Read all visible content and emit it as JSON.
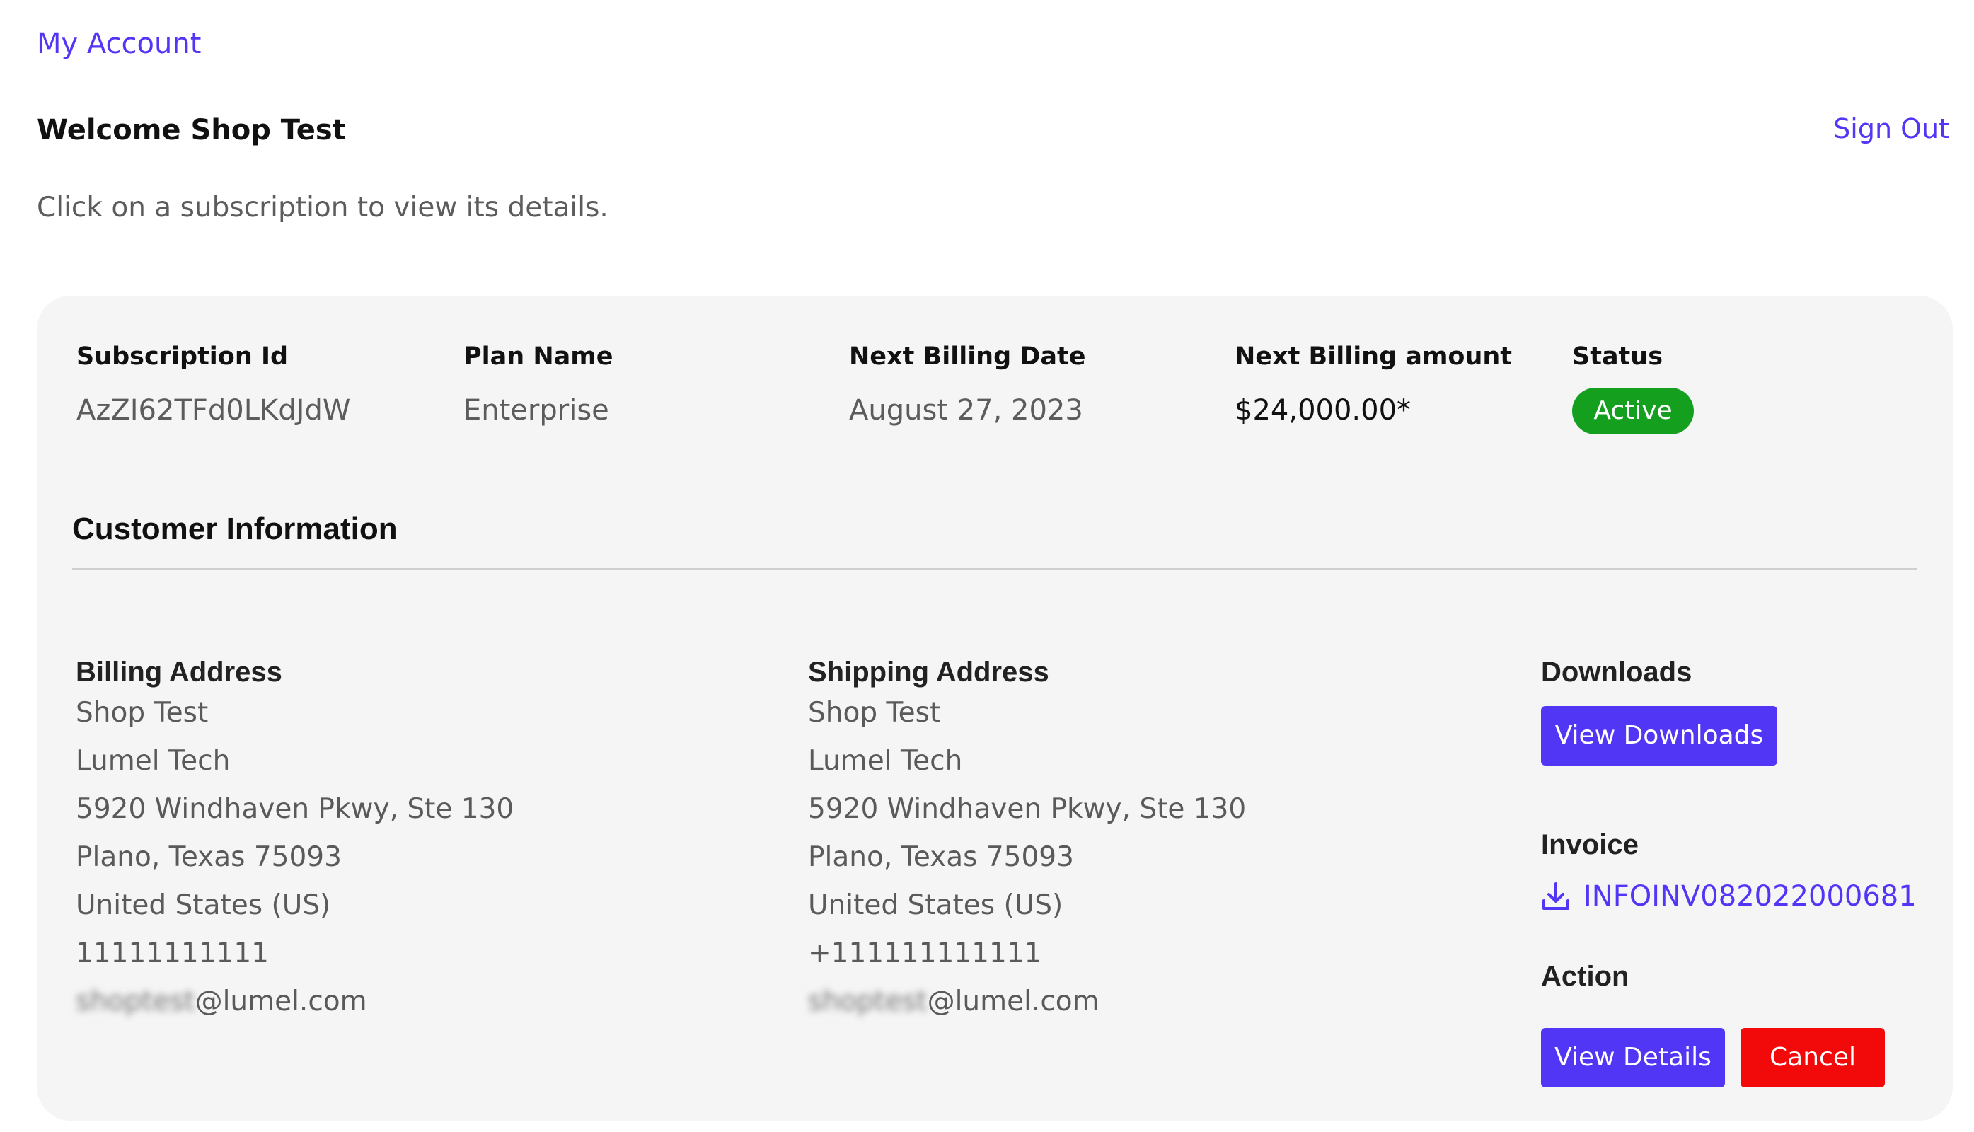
{
  "header": {
    "my_account": "My Account",
    "welcome": "Welcome Shop Test",
    "sign_out": "Sign Out",
    "hint": "Click on a subscription to view its details."
  },
  "subscription": {
    "columns": {
      "id": "Subscription Id",
      "plan": "Plan Name",
      "next_date": "Next Billing Date",
      "next_amount": "Next Billing amount",
      "status": "Status"
    },
    "values": {
      "id": "AzZI62TFd0LKdJdW",
      "plan": "Enterprise",
      "next_date": "August 27, 2023",
      "next_amount": "$24,000.00*",
      "status": "Active"
    },
    "status_color": "#14a01e"
  },
  "customer": {
    "title": "Customer Information",
    "billing": {
      "heading": "Billing Address",
      "name": "Shop Test",
      "company": "Lumel Tech",
      "street": "5920 Windhaven Pkwy, Ste 130",
      "city": "Plano, Texas 75093",
      "country": "United States (US)",
      "phone": "11111111111",
      "email_blurred": "shoptest",
      "email_domain": "@lumel.com"
    },
    "shipping": {
      "heading": "Shipping Address",
      "name": "Shop Test",
      "company": "Lumel Tech",
      "street": "5920 Windhaven Pkwy, Ste 130",
      "city": "Plano, Texas 75093",
      "country": "United States (US)",
      "phone": "+111111111111",
      "email_blurred": "shoptest",
      "email_domain": "@lumel.com"
    },
    "downloads": {
      "heading": "Downloads",
      "button": "View Downloads"
    },
    "invoice": {
      "heading": "Invoice",
      "number": "INFOINV082022000681",
      "icon": "download-icon"
    },
    "action": {
      "heading": "Action",
      "view_details": "View Details",
      "cancel": "Cancel"
    }
  },
  "colors": {
    "accent": "#5236f6",
    "danger": "#f20a0a",
    "card_bg": "#f5f5f5"
  }
}
